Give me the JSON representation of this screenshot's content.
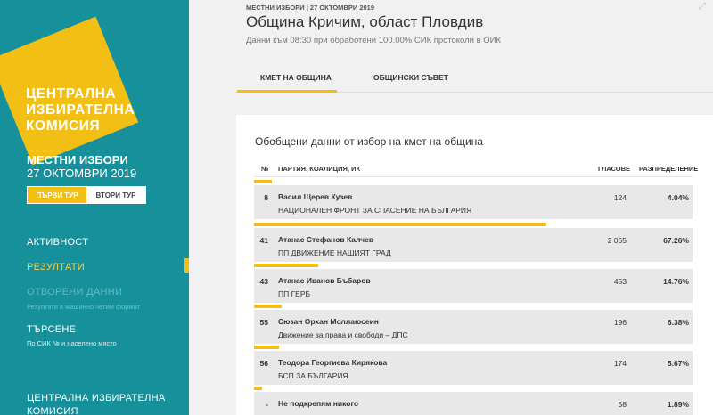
{
  "sidebar": {
    "logo_lines": [
      "ЦЕНТРАЛНА",
      "ИЗБИРАТЕЛНА",
      "КОМИСИЯ"
    ],
    "election_title": "МЕСТНИ ИЗБОРИ",
    "election_date": "27 ОКТОМВРИ 2019",
    "rounds": [
      "ПЪРВИ ТУР",
      "ВТОРИ ТУР"
    ],
    "nav": {
      "activity": "АКТИВНОСТ",
      "results": "РЕЗУЛТАТИ",
      "open_data": "ОТВОРЕНИ ДАННИ",
      "open_data_sub": "Резултати в машинно четим формат",
      "search": "ТЪРСЕНЕ",
      "search_sub": "По СИК № и населено място",
      "cik": "ЦЕНТРАЛНА ИЗБИРАТЕЛНА",
      "cik_line2": "КОМИСИЯ"
    }
  },
  "header": {
    "breadcrumb": "МЕСТНИ ИЗБОРИ | 27 ОКТОМВРИ 2019",
    "title": "Община Кричим, област Пловдив",
    "subtitle": "Данни към 08:30 при обработени 100.00% СИК протоколи в ОИК",
    "tabs": [
      "КМЕТ НА ОБЩИНА",
      "ОБЩИНСКИ СЪВЕТ"
    ]
  },
  "colors": {
    "accent": "#f4bf14",
    "sidebar": "#16919c"
  },
  "table": {
    "title": "Обобщени данни от избор на кмет на община",
    "headers": {
      "num": "№",
      "party": "ПАРТИЯ, КОАЛИЦИЯ, ИК",
      "votes": "ГЛАСОВЕ",
      "share": "РАЗПРЕДЕЛЕНИЕ"
    },
    "rows": [
      {
        "num": "8",
        "name": "Васил Щерев Кузев",
        "party": "НАЦИОНАЛЕН ФРОНТ ЗА СПАСЕНИЕ НА БЪЛГАРИЯ",
        "votes": "124",
        "pct": "4.04%",
        "share": 4.04
      },
      {
        "num": "41",
        "name": "Атанас Стефанов Калчев",
        "party": "ПП ДВИЖЕНИЕ НАШИЯТ ГРАД",
        "votes": "2 065",
        "pct": "67.26%",
        "share": 67.26
      },
      {
        "num": "43",
        "name": "Атанас Иванов Бъбаров",
        "party": "ПП ГЕРБ",
        "votes": "453",
        "pct": "14.76%",
        "share": 14.76
      },
      {
        "num": "55",
        "name": "Сюзан Орхан Моллаюсеин",
        "party": "Движение за права и свободи – ДПС",
        "votes": "196",
        "pct": "6.38%",
        "share": 6.38
      },
      {
        "num": "56",
        "name": "Теодора Георгиева Кирякова",
        "party": "БСП ЗА БЪЛГАРИЯ",
        "votes": "174",
        "pct": "5.67%",
        "share": 5.67
      },
      {
        "num": "-",
        "name": "Не подкрепям никого",
        "party": "",
        "votes": "58",
        "pct": "1.89%",
        "share": 1.89
      }
    ]
  }
}
